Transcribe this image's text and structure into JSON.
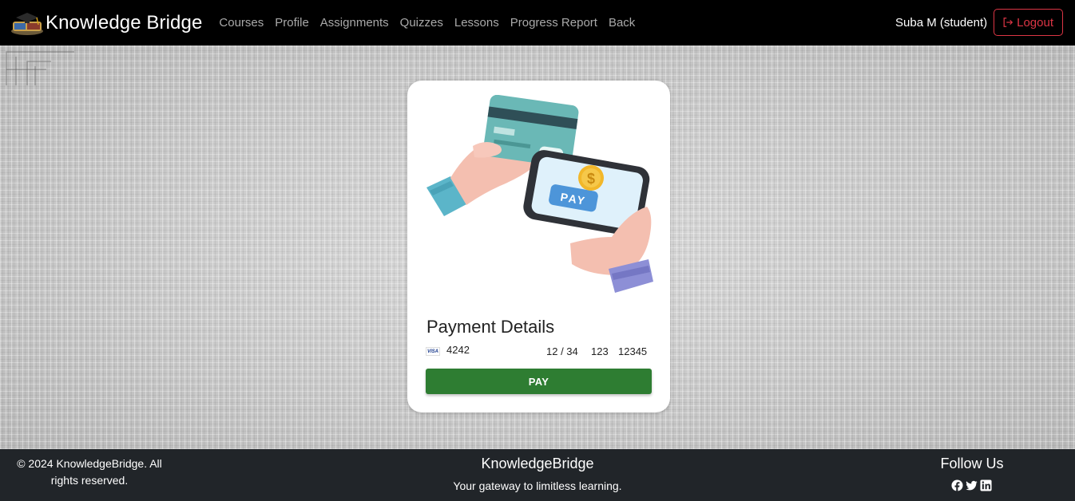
{
  "navbar": {
    "brand": "Knowledge Bridge",
    "links": [
      "Courses",
      "Profile",
      "Assignments",
      "Quizzes",
      "Lessons",
      "Progress Report",
      "Back"
    ],
    "user": "Suba M (student)",
    "logout_label": "Logout"
  },
  "payment": {
    "title": "Payment Details",
    "card_brand": "VISA",
    "card_last4": "4242",
    "expiry": "12 / 34",
    "cvc": "123",
    "zip": "12345",
    "button_label": "PAY",
    "illustration_button_text": "PAY"
  },
  "footer": {
    "copyright": "© 2024 KnowledgeBridge. All rights reserved.",
    "brand": "KnowledgeBridge",
    "tagline": "Your gateway to limitless learning.",
    "follow_title": "Follow Us",
    "social_icons": [
      "facebook-icon",
      "twitter-icon",
      "linkedin-icon"
    ]
  },
  "colors": {
    "navbar_bg": "#000000",
    "logout_red": "#dc3545",
    "pay_green": "#2e7d32",
    "footer_bg": "#212529"
  }
}
